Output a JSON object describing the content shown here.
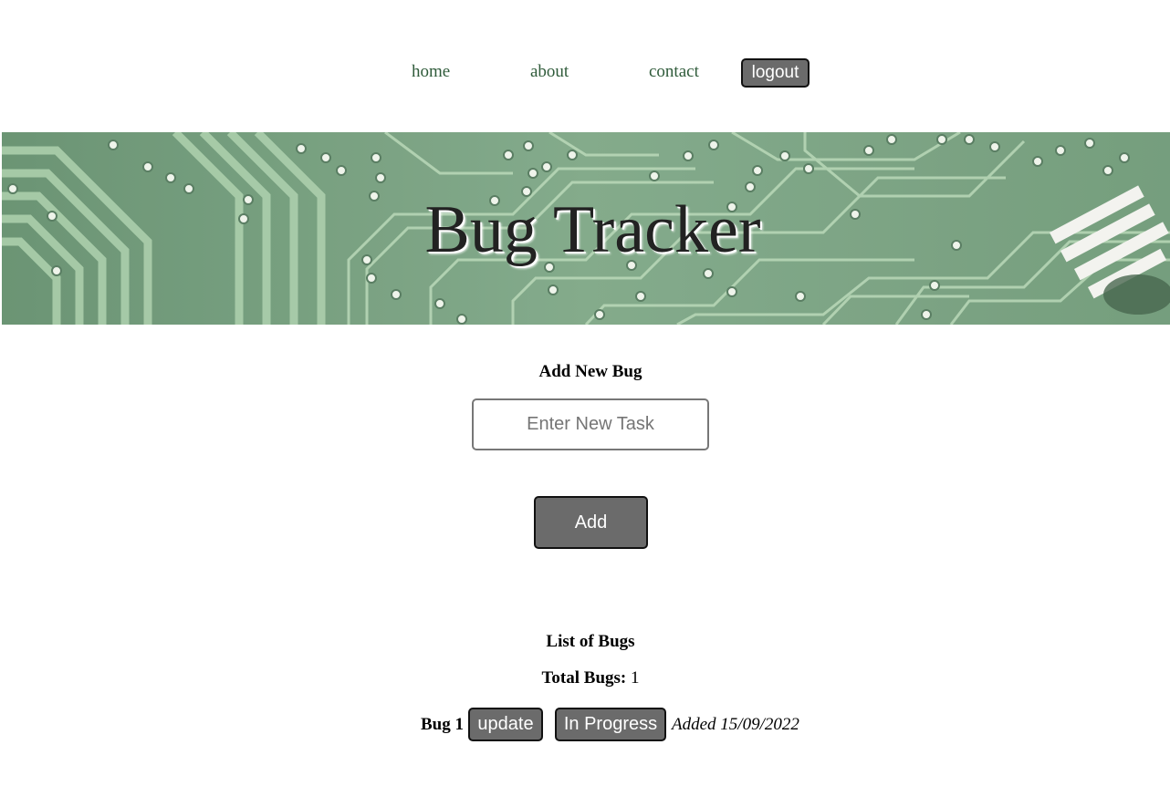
{
  "nav": {
    "home": "home",
    "about": "about",
    "contact": "contact",
    "logout": "logout"
  },
  "banner": {
    "title": "Bug Tracker"
  },
  "add_form": {
    "heading": "Add New Bug",
    "input_placeholder": "Enter New Task",
    "input_value": "",
    "add_button": "Add"
  },
  "list": {
    "heading": "List of Bugs",
    "total_label": "Total Bugs:",
    "total_value": "1",
    "bugs": [
      {
        "name": "Bug 1",
        "update_label": "update",
        "status_label": "In Progress",
        "added_text": "Added 15/09/2022"
      }
    ]
  },
  "colors": {
    "nav_link": "#2f5b3a",
    "button_bg": "#6b6b6b",
    "button_border": "#111111",
    "banner_green": "#6f9a78"
  }
}
